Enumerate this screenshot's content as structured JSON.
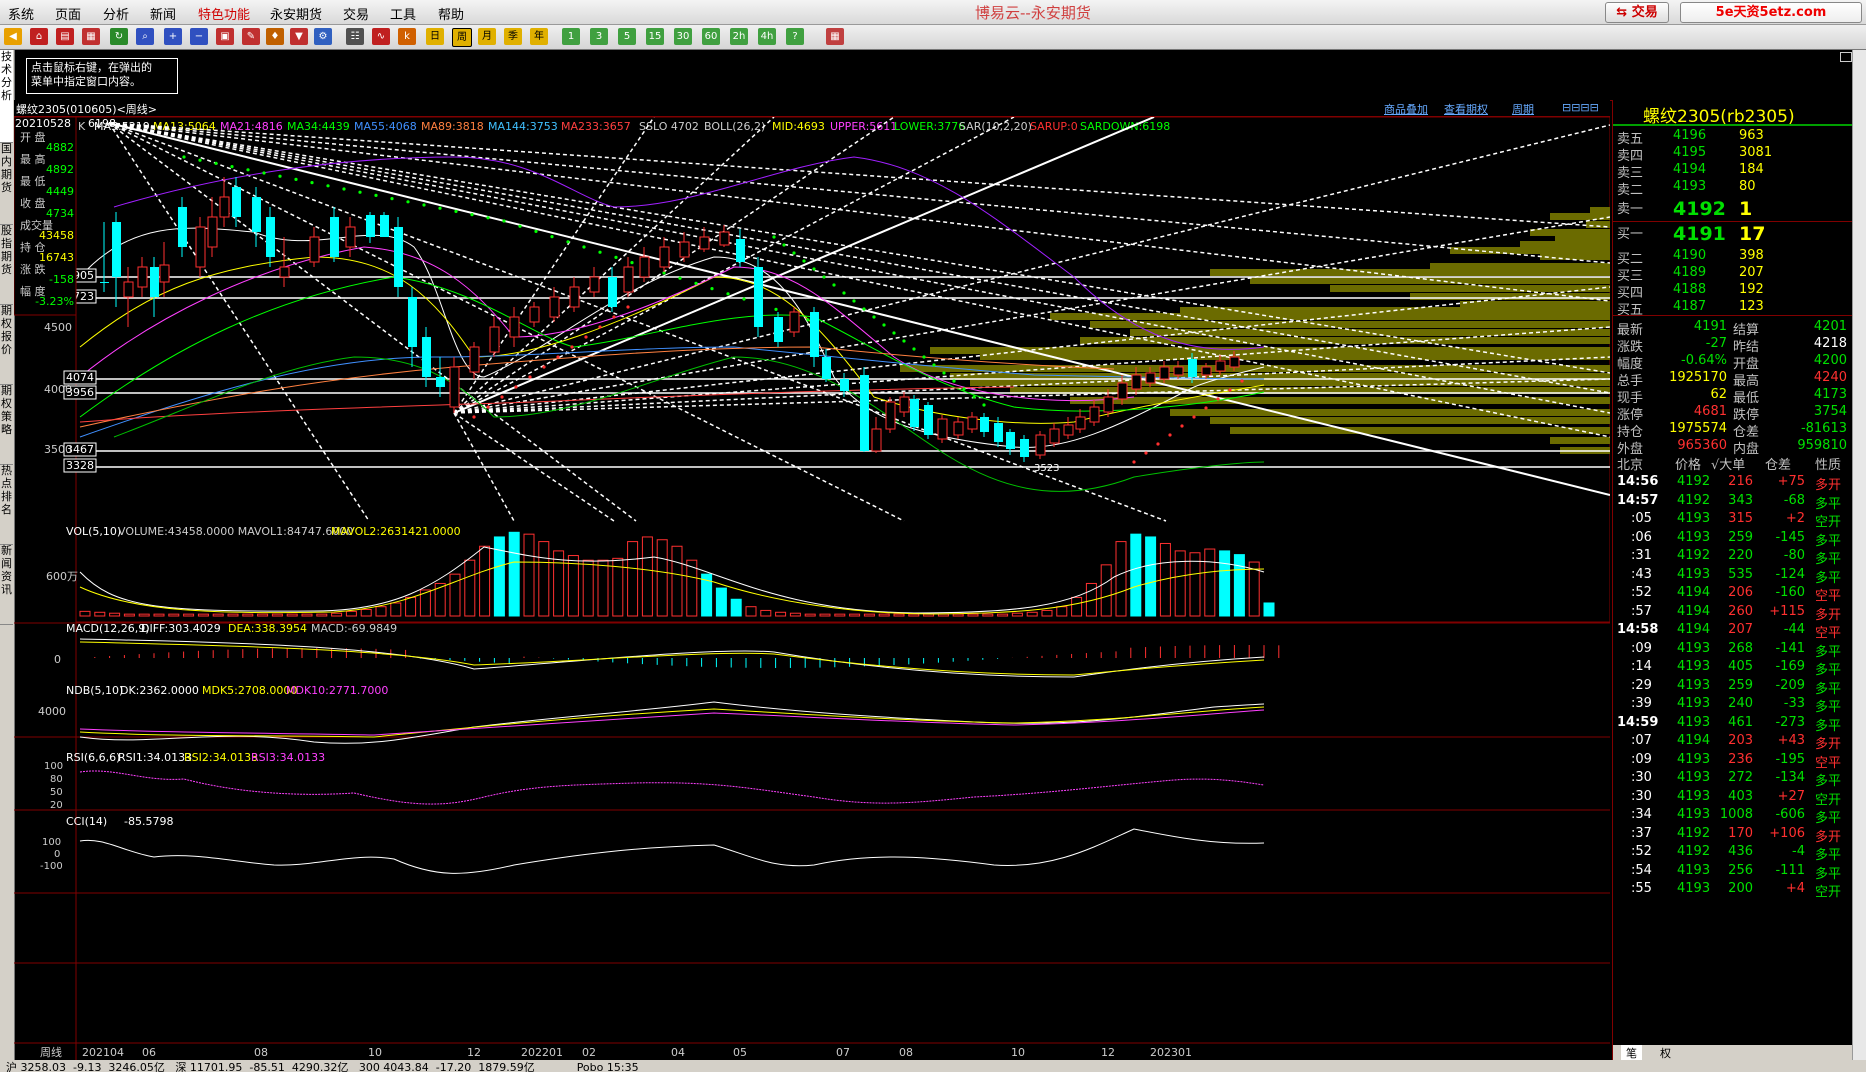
{
  "menu": [
    "系统",
    "页面",
    "分析",
    "新闻",
    "特色功能",
    "永安期货",
    "交易",
    "工具",
    "帮助"
  ],
  "menu_highlight_index": 4,
  "app_title": "博易云--永安期货",
  "trade_button": "交易",
  "watermark": "5e天资5etz.com",
  "toolbar_periods": [
    "日",
    "周",
    "月",
    "季",
    "年",
    "1",
    "3",
    "5",
    "15",
    "30",
    "60",
    "2h",
    "4h",
    "?"
  ],
  "tip": {
    "line1": "点击鼠标右键，在弹出的",
    "line2": "菜单中指定窗口内容。"
  },
  "left_tabs": [
    "技术分析",
    "国内期货",
    "股指期货",
    "期权报价",
    "期权策略",
    "热点排名",
    "新闻资讯"
  ],
  "chart": {
    "symbol_title": "螺纹2305(010605)<周线>",
    "top_links": [
      "商品叠加",
      "查看期权",
      "周期"
    ],
    "ind_line": {
      "k": "K",
      "ma5": "MA5:5219",
      "ma13": "MA13:5064",
      "ma21": "MA21:4816",
      "ma34": "MA34:4439",
      "ma55": "MA55:4068",
      "ma89": "MA89:3818",
      "ma144": "MA144:3753",
      "ma233": "MA233:3657",
      "sslo": "SSLO 4702",
      "boll": "BOLL(26,2)",
      "mid": "MID:4693",
      "upper": "UPPER:5611",
      "lower": "LOWER:3776",
      "sar": "SAR(10,2,20)",
      "sarup": "SARUP:0",
      "sardown": "SARDOWN:6198"
    },
    "info_box": {
      "date": "20210528",
      "fields": [
        {
          "label": "开 盘",
          "value": "4882"
        },
        {
          "label": "最 高",
          "value": "4892"
        },
        {
          "label": "最 低",
          "value": "4449"
        },
        {
          "label": "收 盘",
          "value": "4734"
        },
        {
          "label": "成交量",
          "value": "43458"
        },
        {
          "label": "持 仓",
          "value": "16743"
        },
        {
          "label": "涨 跌",
          "value": "-158"
        },
        {
          "label": "幅 度",
          "value": "-3.23%"
        }
      ]
    },
    "price_tags": [
      "4905",
      "4723",
      "4074",
      "3956",
      "3467",
      "3328"
    ],
    "y_axis": [
      "4500",
      "4000",
      "3500"
    ],
    "high_label": "6198",
    "low_label": "3523",
    "volume": {
      "title": "VOL(5,10)",
      "vals": "VOLUME:43458.0000  MAVOL1:84747.6000",
      "mavol2": "MAVOL2:2631421.0000",
      "axis": "600万"
    },
    "macd": {
      "title": "MACD(12,26,9)",
      "diff": "DIFF:303.4029",
      "dea": "DEA:338.3954",
      "macd": "MACD:-69.9849",
      "axis": "0"
    },
    "ndb": {
      "title": "NDB(5,10)",
      "dk": "DK:2362.0000",
      "mdk5": "MDK5:2708.0000",
      "mdk10": "MDK10:2771.7000",
      "axis": "4000"
    },
    "rsi": {
      "title": "RSI(6,6,6)",
      "r1": "RSI1:34.0133",
      "r2": "RSI2:34.0133",
      "r3": "RSI3:34.0133",
      "axis": [
        "100",
        "80",
        "50",
        "20"
      ]
    },
    "cci": {
      "title": "CCI(14)",
      "val": "-85.5798",
      "axis": [
        "100",
        "0",
        "-100"
      ]
    },
    "x_axis": [
      "周线",
      "202104",
      "06",
      "08",
      "10",
      "12",
      "202201",
      "02",
      "04",
      "05",
      "07",
      "08",
      "10",
      "12",
      "202301"
    ]
  },
  "quote": {
    "title": "螺纹2305(rb2305)",
    "asks": [
      {
        "label": "卖五",
        "price": "4196",
        "vol": "963"
      },
      {
        "label": "卖四",
        "price": "4195",
        "vol": "3081"
      },
      {
        "label": "卖三",
        "price": "4194",
        "vol": "184"
      },
      {
        "label": "卖二",
        "price": "4193",
        "vol": "80"
      }
    ],
    "ask1": {
      "label": "卖一",
      "price": "4192",
      "vol": "1"
    },
    "bid1": {
      "label": "买一",
      "price": "4191",
      "vol": "17"
    },
    "bids": [
      {
        "label": "买二",
        "price": "4190",
        "vol": "398"
      },
      {
        "label": "买三",
        "price": "4189",
        "vol": "207"
      },
      {
        "label": "买四",
        "price": "4188",
        "vol": "192"
      },
      {
        "label": "买五",
        "price": "4187",
        "vol": "123"
      }
    ],
    "stats": [
      {
        "l1": "最新",
        "v1": "4191",
        "c1": "grn",
        "l2": "结算",
        "v2": "4201",
        "c2": "grn"
      },
      {
        "l1": "涨跌",
        "v1": "-27",
        "c1": "grn",
        "l2": "昨结",
        "v2": "4218",
        "c2": "wht"
      },
      {
        "l1": "幅度",
        "v1": "-0.64%",
        "c1": "grn",
        "l2": "开盘",
        "v2": "4200",
        "c2": "grn"
      },
      {
        "l1": "总手",
        "v1": "1925170",
        "c1": "yel",
        "l2": "最高",
        "v2": "4240",
        "c2": "red"
      },
      {
        "l1": "现手",
        "v1": "62",
        "c1": "yel",
        "l2": "最低",
        "v2": "4173",
        "c2": "grn"
      },
      {
        "l1": "涨停",
        "v1": "4681",
        "c1": "red",
        "l2": "跌停",
        "v2": "3754",
        "c2": "grn"
      },
      {
        "l1": "持仓",
        "v1": "1975574",
        "c1": "yel",
        "l2": "仓差",
        "v2": "-81613",
        "c2": "grn"
      },
      {
        "l1": "外盘",
        "v1": "965360",
        "c1": "red",
        "l2": "内盘",
        "v2": "959810",
        "c2": "grn"
      }
    ],
    "ticks_header": [
      "北京",
      "价格",
      "√大单",
      "仓差",
      "性质"
    ],
    "ticks": [
      {
        "t": "14:56",
        "big": true,
        "p": "4192",
        "v": "216",
        "vc": "red",
        "d": "+75",
        "dc": "red",
        "n": "多开",
        "nc": "red"
      },
      {
        "t": "14:57",
        "big": true,
        "p": "4192",
        "v": "343",
        "vc": "grn",
        "d": "-68",
        "dc": "grn",
        "n": "多平",
        "nc": "grn"
      },
      {
        "t": ":05",
        "big": false,
        "p": "4193",
        "v": "315",
        "vc": "red",
        "d": "+2",
        "dc": "red",
        "n": "空开",
        "nc": "grn"
      },
      {
        "t": ":06",
        "big": false,
        "p": "4193",
        "v": "259",
        "vc": "grn",
        "d": "-145",
        "dc": "grn",
        "n": "多平",
        "nc": "grn"
      },
      {
        "t": ":31",
        "big": false,
        "p": "4192",
        "v": "220",
        "vc": "grn",
        "d": "-80",
        "dc": "grn",
        "n": "多平",
        "nc": "grn"
      },
      {
        "t": ":43",
        "big": false,
        "p": "4193",
        "v": "535",
        "vc": "grn",
        "d": "-124",
        "dc": "grn",
        "n": "多平",
        "nc": "grn"
      },
      {
        "t": ":52",
        "big": false,
        "p": "4194",
        "v": "206",
        "vc": "red",
        "d": "-160",
        "dc": "grn",
        "n": "空平",
        "nc": "red"
      },
      {
        "t": ":57",
        "big": false,
        "p": "4194",
        "v": "260",
        "vc": "red",
        "d": "+115",
        "dc": "red",
        "n": "多开",
        "nc": "red"
      },
      {
        "t": "14:58",
        "big": true,
        "p": "4194",
        "v": "207",
        "vc": "red",
        "d": "-44",
        "dc": "grn",
        "n": "空平",
        "nc": "red"
      },
      {
        "t": ":09",
        "big": false,
        "p": "4193",
        "v": "268",
        "vc": "grn",
        "d": "-141",
        "dc": "grn",
        "n": "多平",
        "nc": "grn"
      },
      {
        "t": ":14",
        "big": false,
        "p": "4193",
        "v": "405",
        "vc": "grn",
        "d": "-169",
        "dc": "grn",
        "n": "多平",
        "nc": "grn"
      },
      {
        "t": ":29",
        "big": false,
        "p": "4193",
        "v": "259",
        "vc": "grn",
        "d": "-209",
        "dc": "grn",
        "n": "多平",
        "nc": "grn"
      },
      {
        "t": ":39",
        "big": false,
        "p": "4193",
        "v": "240",
        "vc": "grn",
        "d": "-33",
        "dc": "grn",
        "n": "多平",
        "nc": "grn"
      },
      {
        "t": "14:59",
        "big": true,
        "p": "4193",
        "v": "461",
        "vc": "grn",
        "d": "-273",
        "dc": "grn",
        "n": "多平",
        "nc": "grn"
      },
      {
        "t": ":07",
        "big": false,
        "p": "4194",
        "v": "203",
        "vc": "red",
        "d": "+43",
        "dc": "red",
        "n": "多开",
        "nc": "red"
      },
      {
        "t": ":09",
        "big": false,
        "p": "4193",
        "v": "236",
        "vc": "red",
        "d": "-195",
        "dc": "grn",
        "n": "空平",
        "nc": "red"
      },
      {
        "t": ":30",
        "big": false,
        "p": "4193",
        "v": "272",
        "vc": "grn",
        "d": "-134",
        "dc": "grn",
        "n": "多平",
        "nc": "grn"
      },
      {
        "t": ":30",
        "big": false,
        "p": "4193",
        "v": "403",
        "vc": "grn",
        "d": "+27",
        "dc": "red",
        "n": "空开",
        "nc": "grn"
      },
      {
        "t": ":34",
        "big": false,
        "p": "4193",
        "v": "1008",
        "vc": "grn",
        "d": "-606",
        "dc": "grn",
        "n": "多平",
        "nc": "grn"
      },
      {
        "t": ":37",
        "big": false,
        "p": "4192",
        "v": "170",
        "vc": "red",
        "d": "+106",
        "dc": "red",
        "n": "多开",
        "nc": "red"
      },
      {
        "t": ":52",
        "big": false,
        "p": "4192",
        "v": "436",
        "vc": "grn",
        "d": "-4",
        "dc": "grn",
        "n": "多平",
        "nc": "grn"
      },
      {
        "t": ":54",
        "big": false,
        "p": "4193",
        "v": "256",
        "vc": "grn",
        "d": "-111",
        "dc": "grn",
        "n": "多平",
        "nc": "grn"
      },
      {
        "t": ":55",
        "big": false,
        "p": "4193",
        "v": "200",
        "vc": "grn",
        "d": "+4",
        "dc": "red",
        "n": "空开",
        "nc": "grn"
      }
    ],
    "bottom_tabs": [
      "笔",
      "权"
    ]
  },
  "statusbar": "沪 3258.03  -9.13  3246.05亿   深 11701.95  -85.51  4290.32亿   300 4043.84  -17.20  1879.59亿            Pobo 15:35"
}
